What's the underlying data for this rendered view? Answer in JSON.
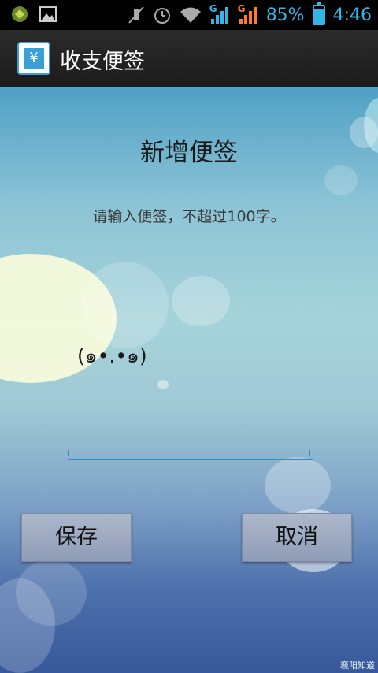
{
  "status_bar": {
    "battery_percent": "85%",
    "battery_level": 0.85,
    "time": "4:46",
    "network_type": "G",
    "icons": [
      "notification-icon",
      "image-icon",
      "mute-icon",
      "alarm-icon",
      "wifi-icon",
      "signal-icon",
      "signal-icon",
      "battery-icon"
    ]
  },
  "action_bar": {
    "app_icon_glyph": "¥",
    "title": "收支便签"
  },
  "form": {
    "title": "新增便签",
    "hint": "请输入便签，不超过100字。",
    "input_value": "(๑•.•๑)"
  },
  "buttons": {
    "save": "保存",
    "cancel": "取消"
  },
  "watermark": "襄阳知道",
  "colors": {
    "status_accent": "#33b5e5",
    "input_underline": "#2d8fd0"
  }
}
